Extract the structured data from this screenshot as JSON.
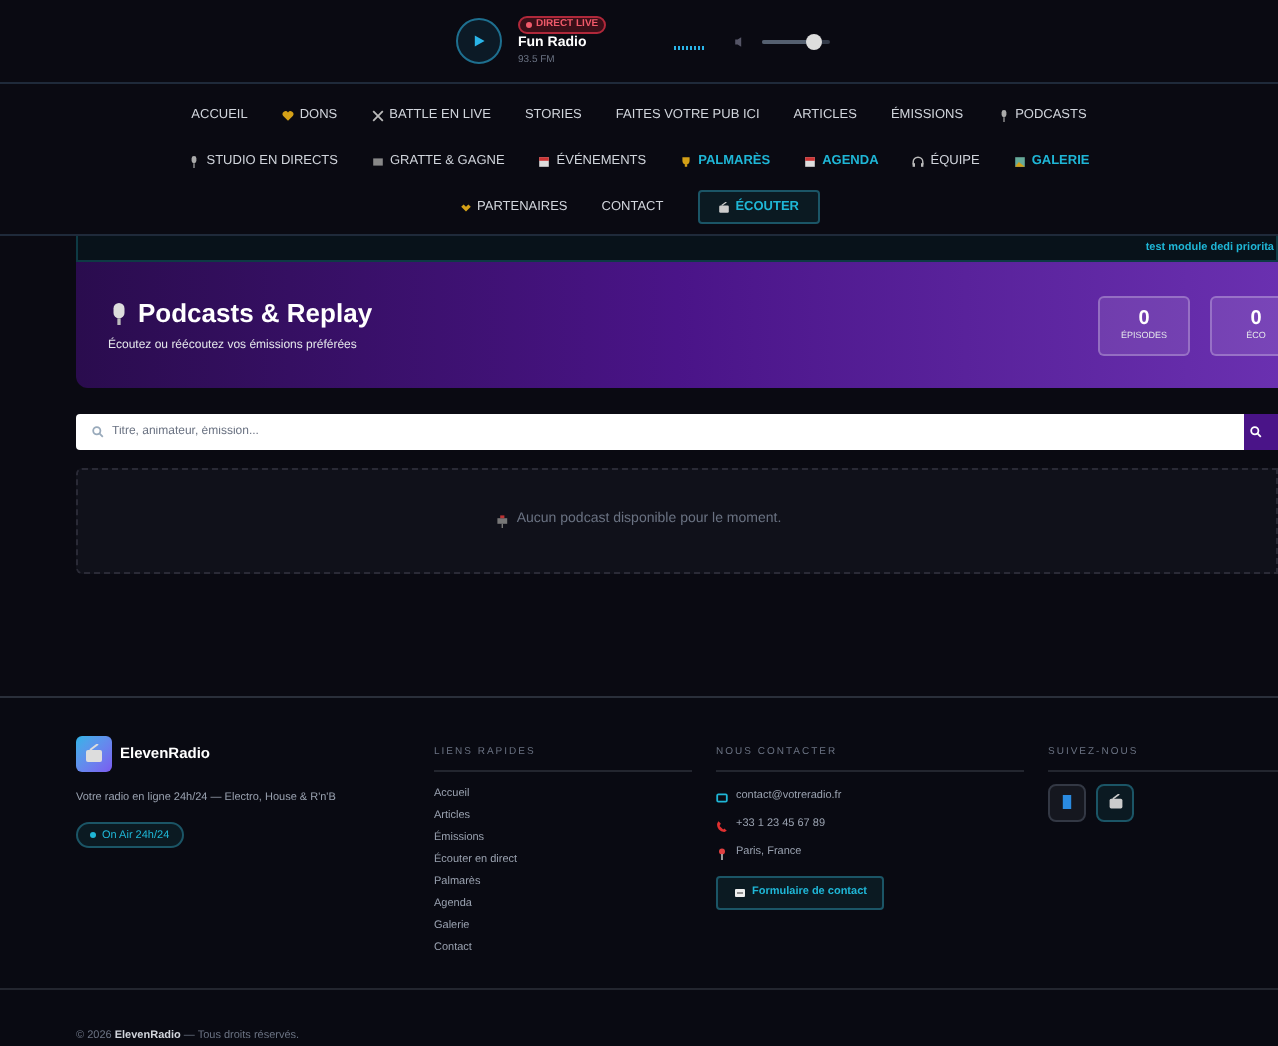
{
  "player": {
    "badge": "DIRECT LIVE",
    "station": "Fun Radio",
    "frequency": "93.5 FM",
    "volume": {
      "level": 0.75
    }
  },
  "nav": {
    "items": [
      {
        "label": "ACCUEIL",
        "highlighted": false
      },
      {
        "label": "DONS",
        "highlighted": false
      },
      {
        "label": "BATTLE EN LIVE",
        "highlighted": false
      },
      {
        "label": "STORIES",
        "highlighted": false
      },
      {
        "label": "FAITES VOTRE PUB ICI",
        "highlighted": false
      },
      {
        "label": "ARTICLES",
        "highlighted": false
      },
      {
        "label": "ÉMISSIONS",
        "highlighted": false
      },
      {
        "label": "PODCASTS",
        "highlighted": false
      },
      {
        "label": "STUDIO EN DIRECTS",
        "highlighted": false
      },
      {
        "label": "GRATTE & GAGNE",
        "highlighted": false
      },
      {
        "label": "ÉVÉNEMENTS",
        "highlighted": false
      },
      {
        "label": "PALMARÈS",
        "highlighted": true
      },
      {
        "label": "AGENDA",
        "highlighted": true
      },
      {
        "label": "ÉQUIPE",
        "highlighted": false
      },
      {
        "label": "GALERIE",
        "highlighted": true
      },
      {
        "label": "PARTENAIRES",
        "highlighted": false
      },
      {
        "label": "CONTACT",
        "highlighted": false
      },
      {
        "label": "ÉCOUTER",
        "highlighted": true
      }
    ]
  },
  "ticker": "test module dedi priorita",
  "hero": {
    "title": "Podcasts & Replay",
    "subtitle": "Écoutez ou réécoutez vos émissions préférées",
    "stats": [
      {
        "value": "0",
        "label": "ÉPISODES"
      },
      {
        "value": "0",
        "label": "ÉCO"
      }
    ]
  },
  "search": {
    "placeholder": "Titre, animateur, émission..."
  },
  "empty_message": "Aucun podcast disponible pour le moment.",
  "footer": {
    "brand": "ElevenRadio",
    "tagline": "Votre radio en ligne 24h/24 — Electro, House & R'n'B",
    "on_air": "On Air 24h/24",
    "quick_links": {
      "heading": "LIENS RAPIDES",
      "items": [
        "Accueil",
        "Articles",
        "Émissions",
        "Écouter en direct",
        "Palmarès",
        "Agenda",
        "Galerie",
        "Contact"
      ]
    },
    "contact": {
      "heading": "NOUS CONTACTER",
      "items": [
        "contact@votreradio.fr",
        "+33 1 23 45 67 89",
        "Paris, France"
      ],
      "button": "Formulaire de contact"
    },
    "social": {
      "heading": "SUIVEZ-NOUS"
    },
    "copyright": "© 2026 **ElevenRadio** — Tous droits réservés."
  }
}
